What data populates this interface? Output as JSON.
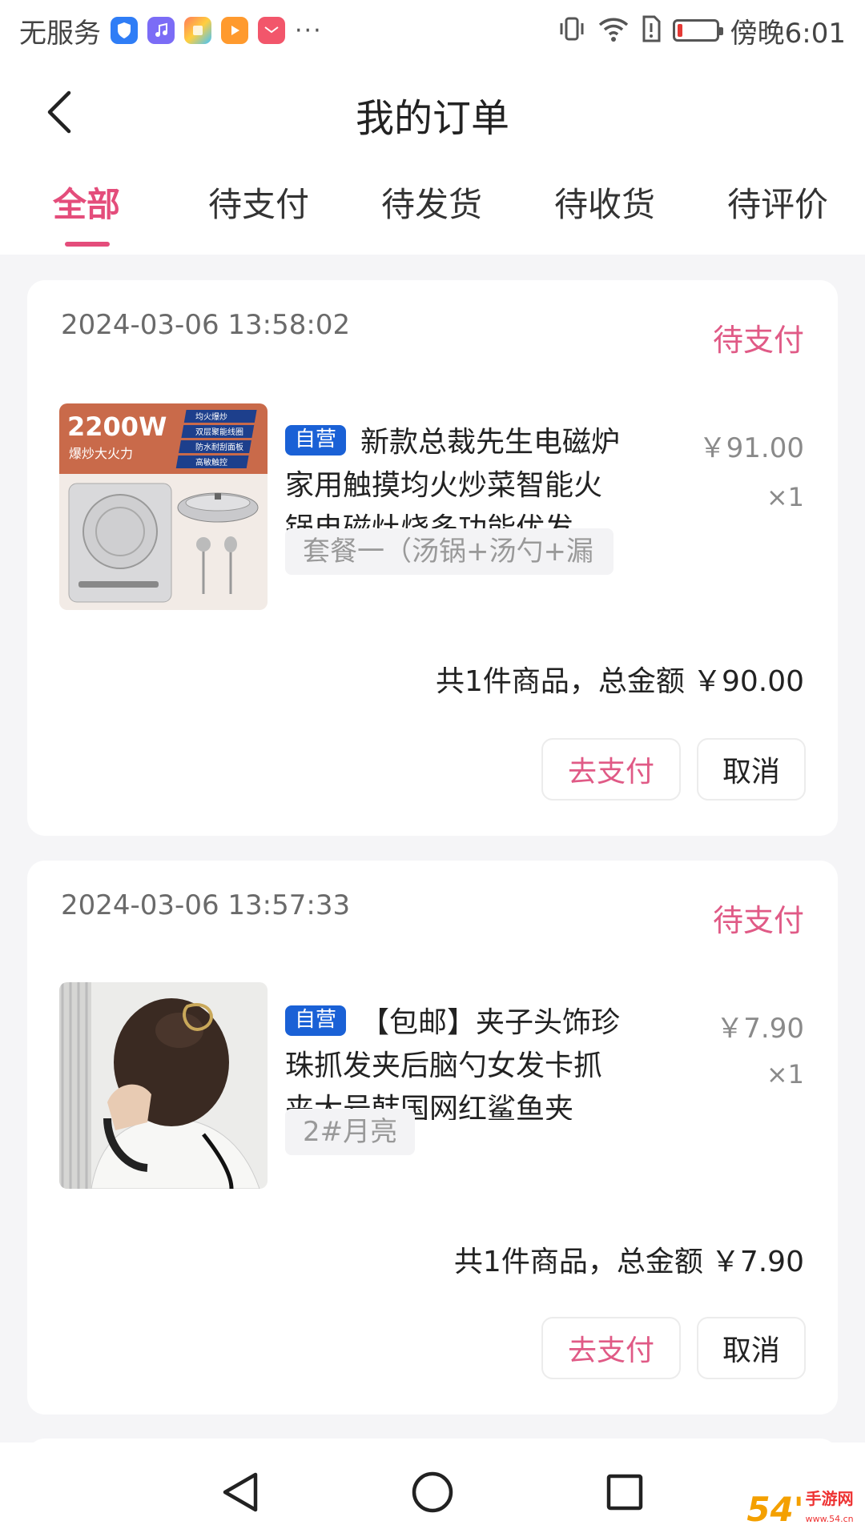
{
  "status_bar": {
    "carrier": "无服务",
    "more": "···",
    "time": "傍晚6:01",
    "app_icons": [
      "shield-app-icon",
      "music-app-icon",
      "store-app-icon",
      "video-app-icon",
      "huawei-app-icon"
    ],
    "battery_fraction": 0.08
  },
  "header": {
    "title": "我的订单"
  },
  "tabs": [
    {
      "label": "全部",
      "active": true
    },
    {
      "label": "待支付",
      "active": false
    },
    {
      "label": "待发货",
      "active": false
    },
    {
      "label": "待收货",
      "active": false
    },
    {
      "label": "待评价",
      "active": false
    }
  ],
  "orders": [
    {
      "time": "2024-03-06 13:58:02",
      "status": "待支付",
      "badge": "自营",
      "product_title": "新款总裁先生电磁炉家用触摸均火炒菜智能火锅电磁灶烧多功能优发",
      "spec": "套餐一（汤锅+汤勺+漏",
      "price": "￥91.00",
      "qty": "×1",
      "summary_label": "共1件商品，总金额",
      "summary_amount": "￥90.00",
      "pay_label": "去支付",
      "cancel_label": "取消",
      "thumb": {
        "power": "2200W",
        "slogan": "爆炒大火力",
        "features": [
          "均火爆炒",
          "双层聚能线圈",
          "防水耐刮面板",
          "高敏触控"
        ]
      }
    },
    {
      "time": "2024-03-06 13:57:33",
      "status": "待支付",
      "badge": "自营",
      "product_title": "【包邮】夹子头饰珍珠抓发夹后脑勺女发卡抓夹大号韩国网红鲨鱼夹",
      "spec": "2#月亮",
      "price": "￥7.90",
      "qty": "×1",
      "summary_label": "共1件商品，总金额",
      "summary_amount": "￥7.90",
      "pay_label": "去支付",
      "cancel_label": "取消"
    }
  ],
  "nav": {
    "back": "back-triangle-icon",
    "home": "home-circle-icon",
    "recents": "recents-square-icon"
  },
  "watermark": {
    "brand": "54'",
    "text": "手游网",
    "domain": "www.54.cn"
  },
  "colors": {
    "accent": "#e44d7b",
    "status_pink": "#e05a86",
    "badge_blue": "#1a61d6",
    "background": "#f5f5f7"
  }
}
